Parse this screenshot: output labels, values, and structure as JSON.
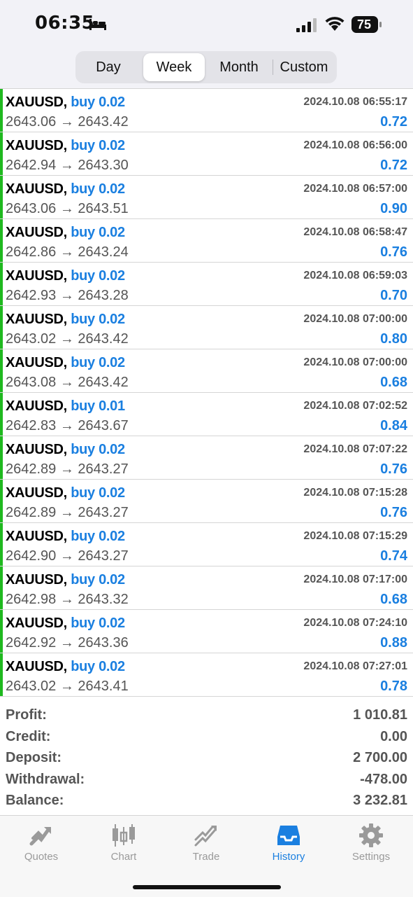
{
  "status_bar": {
    "time": "06:35",
    "battery": "75"
  },
  "segments": {
    "items": [
      "Day",
      "Week",
      "Month",
      "Custom"
    ],
    "active": "Week"
  },
  "trades": [
    {
      "symbol": "XAUUSD,",
      "type": "buy 0.02",
      "date": "2024.10.08 06:55:17",
      "prices": "2643.06 → 2643.42",
      "profit": "0.72"
    },
    {
      "symbol": "XAUUSD,",
      "type": "buy 0.02",
      "date": "2024.10.08 06:56:00",
      "prices": "2642.94 → 2643.30",
      "profit": "0.72"
    },
    {
      "symbol": "XAUUSD,",
      "type": "buy 0.02",
      "date": "2024.10.08 06:57:00",
      "prices": "2643.06 → 2643.51",
      "profit": "0.90"
    },
    {
      "symbol": "XAUUSD,",
      "type": "buy 0.02",
      "date": "2024.10.08 06:58:47",
      "prices": "2642.86 → 2643.24",
      "profit": "0.76"
    },
    {
      "symbol": "XAUUSD,",
      "type": "buy 0.02",
      "date": "2024.10.08 06:59:03",
      "prices": "2642.93 → 2643.28",
      "profit": "0.70"
    },
    {
      "symbol": "XAUUSD,",
      "type": "buy 0.02",
      "date": "2024.10.08 07:00:00",
      "prices": "2643.02 → 2643.42",
      "profit": "0.80"
    },
    {
      "symbol": "XAUUSD,",
      "type": "buy 0.02",
      "date": "2024.10.08 07:00:00",
      "prices": "2643.08 → 2643.42",
      "profit": "0.68"
    },
    {
      "symbol": "XAUUSD,",
      "type": "buy 0.01",
      "date": "2024.10.08 07:02:52",
      "prices": "2642.83 → 2643.67",
      "profit": "0.84"
    },
    {
      "symbol": "XAUUSD,",
      "type": "buy 0.02",
      "date": "2024.10.08 07:07:22",
      "prices": "2642.89 → 2643.27",
      "profit": "0.76"
    },
    {
      "symbol": "XAUUSD,",
      "type": "buy 0.02",
      "date": "2024.10.08 07:15:28",
      "prices": "2642.89 → 2643.27",
      "profit": "0.76"
    },
    {
      "symbol": "XAUUSD,",
      "type": "buy 0.02",
      "date": "2024.10.08 07:15:29",
      "prices": "2642.90 → 2643.27",
      "profit": "0.74"
    },
    {
      "symbol": "XAUUSD,",
      "type": "buy 0.02",
      "date": "2024.10.08 07:17:00",
      "prices": "2642.98 → 2643.32",
      "profit": "0.68"
    },
    {
      "symbol": "XAUUSD,",
      "type": "buy 0.02",
      "date": "2024.10.08 07:24:10",
      "prices": "2642.92 → 2643.36",
      "profit": "0.88"
    },
    {
      "symbol": "XAUUSD,",
      "type": "buy 0.02",
      "date": "2024.10.08 07:27:01",
      "prices": "2643.02 → 2643.41",
      "profit": "0.78"
    }
  ],
  "summary": [
    {
      "label": "Profit:",
      "value": "1 010.81"
    },
    {
      "label": "Credit:",
      "value": "0.00"
    },
    {
      "label": "Deposit:",
      "value": "2 700.00"
    },
    {
      "label": "Withdrawal:",
      "value": "-478.00"
    },
    {
      "label": "Balance:",
      "value": "3 232.81"
    }
  ],
  "tabs": [
    {
      "label": "Quotes",
      "icon": "quotes-icon"
    },
    {
      "label": "Chart",
      "icon": "chart-icon"
    },
    {
      "label": "Trade",
      "icon": "trade-icon"
    },
    {
      "label": "History",
      "icon": "history-icon"
    },
    {
      "label": "Settings",
      "icon": "settings-icon"
    }
  ],
  "active_tab": "History",
  "colors": {
    "accent": "#1a7fe0",
    "buy_bar": "#1fb91f",
    "muted_text": "#555555",
    "inactive_tab": "#9a9a9a"
  }
}
